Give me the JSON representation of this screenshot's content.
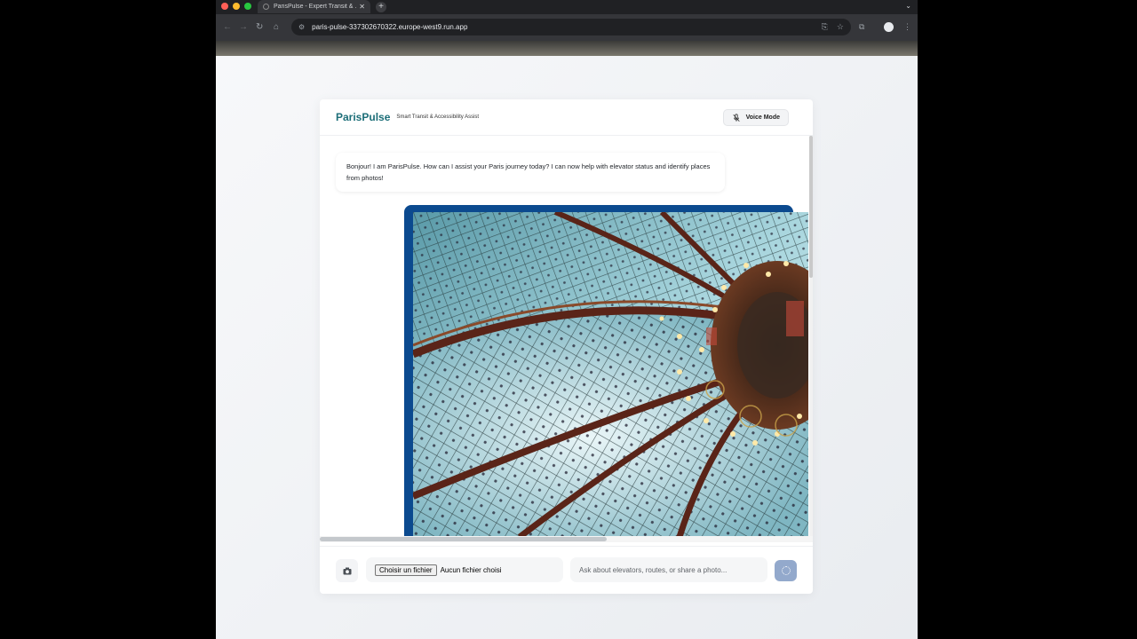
{
  "browser": {
    "tab_title": "ParisPulse - Expert Transit & ...",
    "tab_close": "✕",
    "new_tab": "+",
    "url": "paris-pulse-337302670322.europe-west9.run.app"
  },
  "app": {
    "logo": "ParisPulse",
    "tagline": "Smart Transit & Accessibility Assist",
    "voice_button_label": "Voice Mode"
  },
  "messages": [
    {
      "role": "assistant",
      "text": "Bonjour! I am ParisPulse. How can I assist your Paris journey today? I can now help with elevator status and identify places from photos!"
    },
    {
      "role": "user",
      "attachment": "photo"
    }
  ],
  "composer": {
    "file_button_label": "Choisir un fichier",
    "file_status": "Aucun fichier choisi",
    "input_placeholder": "Ask about elevators, routes, or share a photo..."
  },
  "colors": {
    "brand": "#1c6e78",
    "user_bubble": "#0b4a8f",
    "send_button": "#93a9cc"
  }
}
